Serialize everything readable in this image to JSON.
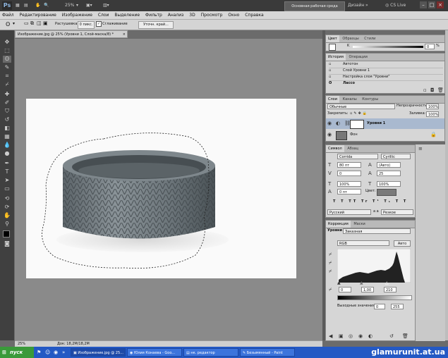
{
  "app": {
    "logo": "Ps",
    "zoom": "25%",
    "workspace": "Основная рабочая среда",
    "design": "Дизайн",
    "cslive": "CS Live"
  },
  "menu": [
    "Файл",
    "Редактирование",
    "Изображение",
    "Слои",
    "Выделение",
    "Фильтр",
    "Анализ",
    "3D",
    "Просмотр",
    "Окно",
    "Справка"
  ],
  "options": {
    "feather_label": "Растушевка:",
    "feather_value": "0 пикс.",
    "antialias_label": "Сглаживание",
    "refine_button": "Уточн. край..."
  },
  "document": {
    "tab_title": "Изображение.jpg @ 25% (Уровни 1, Слой-маска/8) *",
    "status_zoom": "25%",
    "status_doc": "Док: 18,2M/18,2M"
  },
  "color_panel": {
    "tabs": [
      "Цвет",
      "Образцы",
      "Стили"
    ],
    "k_label": "K",
    "k_value": "0",
    "percent": "%"
  },
  "history_panel": {
    "tabs": [
      "История",
      "Операции"
    ],
    "items": [
      "Автотон",
      "Слой Уровни 1",
      "Настройка слоя \"Уровни\"",
      "Лассо"
    ]
  },
  "layers_panel": {
    "tabs": [
      "Слои",
      "Каналы",
      "Контуры"
    ],
    "blend_mode": "Обычные",
    "opacity_label": "Непрозрачность:",
    "opacity_value": "100%",
    "lock_label": "Закрепить:",
    "fill_label": "Заливка:",
    "fill_value": "100%",
    "layers": [
      {
        "name": "Уровни 1"
      },
      {
        "name": "Фон"
      }
    ]
  },
  "char_panel": {
    "tabs": [
      "Символ",
      "Абзац"
    ],
    "font": "Corrida",
    "charset": "Cyrillic",
    "size": "80 пт",
    "leading": "(Авто)",
    "kerning": "0",
    "tracking": "25",
    "vscale": "100%",
    "hscale": "100%",
    "baseline": "0 пт",
    "color_label": "Цвет:",
    "language": "Русский",
    "aa_mode": "Резкое",
    "aa_prefix": "a a"
  },
  "adjust_panel": {
    "tabs": [
      "Коррекция",
      "Маски"
    ],
    "levels_label": "Уровни",
    "preset": "Заказная",
    "channel": "RGB",
    "auto_button": "Авто",
    "input_low": "0",
    "input_mid": "1,00",
    "input_high": "210",
    "output_label": "Выходные значения:",
    "output_low": "0",
    "output_high": "255"
  },
  "taskbar": {
    "start": "пуск",
    "tasks": [
      "Изображение.jpg @ 25...",
      "Юлия Конаева - Goo...",
      "нк. редактор",
      "Безымянный - Paint"
    ],
    "watermark": "glamurunit.at.ua"
  }
}
